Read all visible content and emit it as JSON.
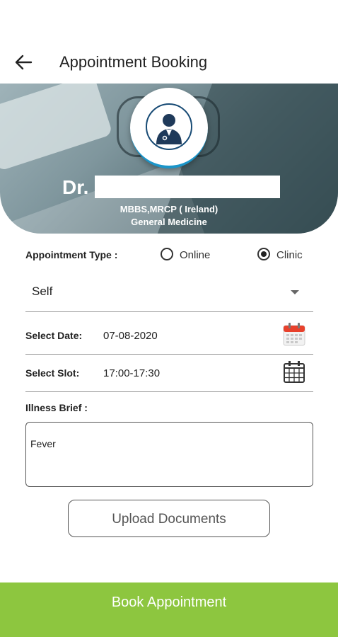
{
  "header": {
    "title": "Appointment Booking",
    "back_icon": "arrow-left-icon"
  },
  "doctor": {
    "prefix": "Dr.",
    "qualifications": "MBBS,MRCP ( Ireland)",
    "specialty": "General Medicine",
    "avatar_icon": "doctor-avatar-icon"
  },
  "appointment_type": {
    "label": "Appointment Type :",
    "options": [
      {
        "label": "Online",
        "selected": false
      },
      {
        "label": "Clinic",
        "selected": true
      }
    ]
  },
  "patient_select": {
    "value": "Self"
  },
  "date": {
    "label": "Select Date:",
    "value": "07-08-2020",
    "icon": "calendar-icon"
  },
  "slot": {
    "label": "Select Slot:",
    "value": "17:00-17:30",
    "icon": "calendar-grid-icon"
  },
  "illness": {
    "label": "Illness Brief :",
    "value": "Fever"
  },
  "upload_button": "Upload Documents",
  "book_button": "Book Appointment",
  "colors": {
    "accent_green": "#8dc63f",
    "avatar_border": "#1b95c9",
    "calendar_red": "#e8412c"
  }
}
